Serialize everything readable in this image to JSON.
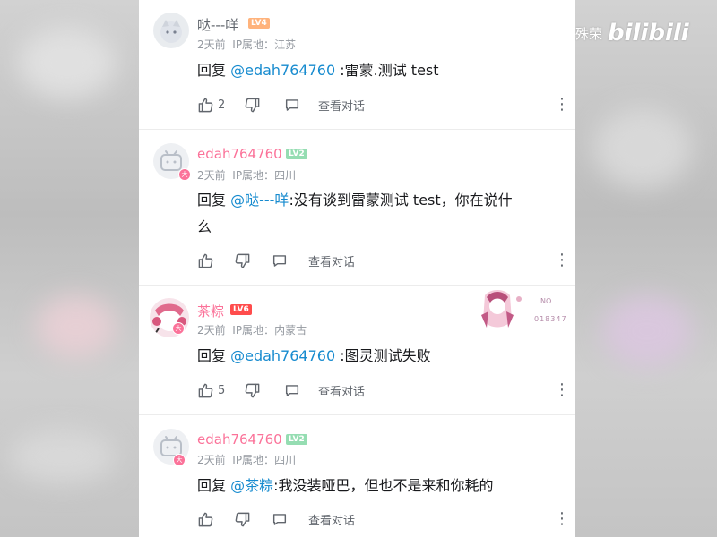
{
  "watermark": {
    "uploader": "雷霆殊荣",
    "logo": "bilibili"
  },
  "comments": [
    {
      "username": "哒---咩",
      "level": "LV4",
      "time": "2天前",
      "ip_label": "IP属地：",
      "ip_location": "江苏",
      "reply_prefix": "回复",
      "mention": "@edah764760",
      "text": ":雷蒙.测试   test",
      "likes": "2",
      "view_dialog": "查看对话"
    },
    {
      "username": "edah764760",
      "level": "LV2",
      "time": "2天前",
      "ip_label": "IP属地：",
      "ip_location": "四川",
      "reply_prefix": "回复",
      "mention": "@哒---咩",
      "text_line1": ":没有谈到雷蒙测试 test，你在说什",
      "text_line2": "么",
      "likes": "",
      "view_dialog": "查看对话"
    },
    {
      "username": "茶粽",
      "level": "LV6",
      "time": "2天前",
      "ip_label": "IP属地：",
      "ip_location": "内蒙古",
      "reply_prefix": "回复",
      "mention": "@edah764760",
      "text": ":图灵测试失败",
      "likes": "5",
      "view_dialog": "查看对话",
      "decoration_label": "NO.",
      "decoration_number": "018347"
    },
    {
      "username": "edah764760",
      "level": "LV2",
      "time": "2天前",
      "ip_label": "IP属地：",
      "ip_location": "四川",
      "reply_prefix": "回复",
      "mention": "@茶粽",
      "text": ":我没装哑巴，但也不是来和你耗的",
      "likes": "",
      "view_dialog": "查看对话"
    }
  ],
  "avatar_badge": "大",
  "colors": {
    "lv2": "#95ddb2",
    "lv4": "#ffb37c",
    "lv6": "#ff4c4c",
    "mention": "#178bcf",
    "vip_name": "#fb7299"
  },
  "icons": [
    "thumb-up-icon",
    "thumb-down-icon",
    "comment-bubble-icon",
    "more-vertical-icon"
  ]
}
